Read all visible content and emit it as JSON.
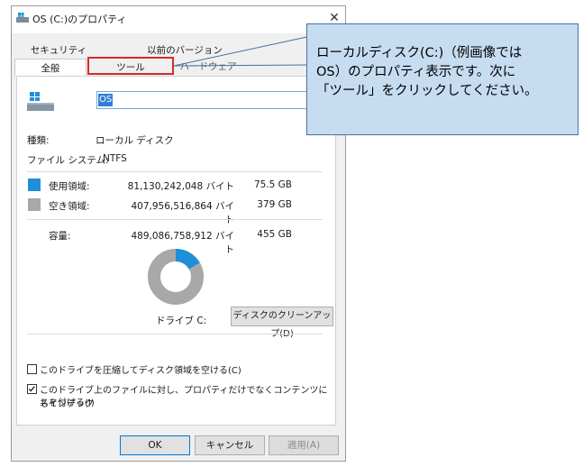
{
  "window": {
    "title": "OS (C:)のプロパティ",
    "close_symbol": "✕"
  },
  "tabs": {
    "security": "セキュリティ",
    "previous_versions": "以前のバージョン",
    "general": "全般",
    "tools": "ツール",
    "hardware": "ハードウェア"
  },
  "drive": {
    "name_value": "OS",
    "type_label": "種類:",
    "type_value": "ローカル ディスク",
    "fs_label": "ファイル システム:",
    "fs_value": "NTFS"
  },
  "usage": {
    "used_label": "使用領域:",
    "used_bytes": "81,130,242,048 バイト",
    "used_gb": "75.5 GB",
    "free_label": "空き領域:",
    "free_bytes": "407,956,516,864 バイト",
    "free_gb": "379 GB",
    "capacity_label": "容量:",
    "capacity_bytes": "489,086,758,912 バイト",
    "capacity_gb": "455 GB",
    "used_fraction": 0.166,
    "drive_caption": "ドライブ C:",
    "cleanup_label": "ディスクのクリーンアップ(D)"
  },
  "options": {
    "compress_label": "このドライブを圧縮してディスク領域を空ける(C)",
    "compress_checked": false,
    "index_label_1": "このドライブ上のファイルに対し、プロパティだけでなくコンテンツにもインデック",
    "index_label_2": "スを付ける(I)",
    "index_checked": true
  },
  "buttons": {
    "ok": "OK",
    "cancel": "キャンセル",
    "apply": "適用(A)"
  },
  "callout": {
    "line1": "ローカルディスク(C:)（例画像では",
    "line2": "OS）のプロパティ表示です。次に",
    "line3": "「ツール」をクリックしてください。"
  },
  "colors": {
    "used": "#1e90d8",
    "free": "#a8a8a8",
    "highlight": "#d42b2b",
    "callout_bg": "#c6dcf1"
  },
  "icons": {
    "app": "drive-icon",
    "drive": "hard-drive-icon",
    "check": "checkmark-icon"
  }
}
